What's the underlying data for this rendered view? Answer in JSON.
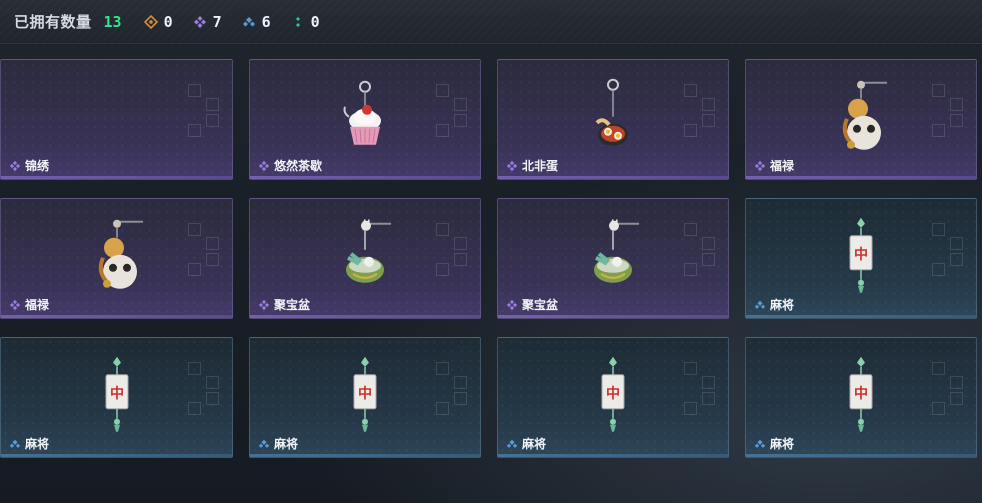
{
  "header": {
    "owned_label": "已拥有数量",
    "owned_count": "13",
    "stats": [
      {
        "icon": "orange-rarity-icon",
        "color": "#d9893a",
        "value": "0"
      },
      {
        "icon": "purple-rarity-icon",
        "color": "#9a7ce0",
        "value": "7"
      },
      {
        "icon": "blue-rarity-icon",
        "color": "#5a9ad8",
        "value": "6"
      },
      {
        "icon": "green-rarity-icon",
        "color": "#3ec48a",
        "value": "0"
      }
    ]
  },
  "colors": {
    "purple": "#9a7ce0",
    "blue": "#5a9ad8",
    "count_green": "#33e68a"
  },
  "items": [
    {
      "name": "锦绣",
      "rarity": "purple",
      "icon": "empty-charm"
    },
    {
      "name": "悠然茶歇",
      "rarity": "purple",
      "icon": "cupcake-charm-icon"
    },
    {
      "name": "北非蛋",
      "rarity": "purple",
      "icon": "shakshuka-charm-icon"
    },
    {
      "name": "福禄",
      "rarity": "purple",
      "icon": "gourd-charm-icon"
    },
    {
      "name": "福禄",
      "rarity": "purple",
      "icon": "gourd-charm-icon"
    },
    {
      "name": "聚宝盆",
      "rarity": "purple",
      "icon": "treasure-bowl-charm-icon"
    },
    {
      "name": "聚宝盆",
      "rarity": "purple",
      "icon": "treasure-bowl-charm-icon"
    },
    {
      "name": "麻将",
      "rarity": "blue",
      "icon": "mahjong-charm-icon"
    },
    {
      "name": "麻将",
      "rarity": "blue",
      "icon": "mahjong-charm-icon"
    },
    {
      "name": "麻将",
      "rarity": "blue",
      "icon": "mahjong-charm-icon"
    },
    {
      "name": "麻将",
      "rarity": "blue",
      "icon": "mahjong-charm-icon"
    },
    {
      "name": "麻将",
      "rarity": "blue",
      "icon": "mahjong-charm-icon"
    }
  ]
}
